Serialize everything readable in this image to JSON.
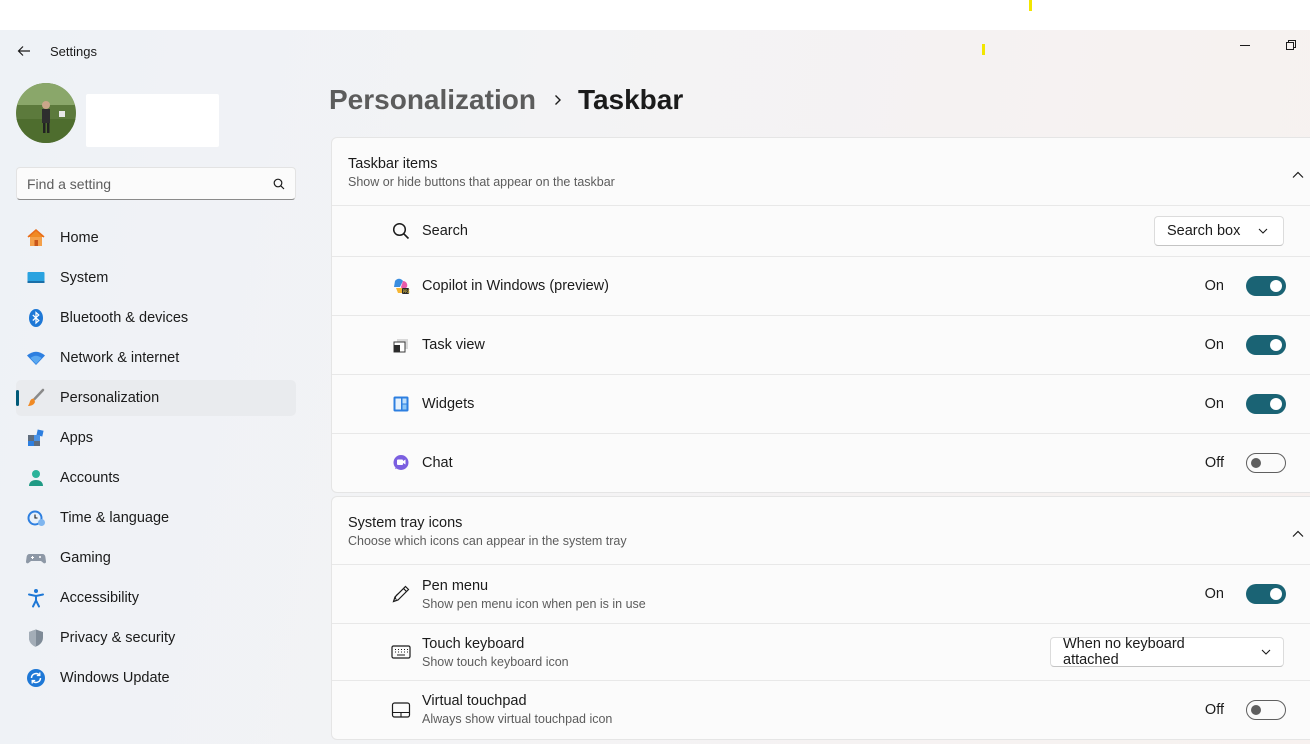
{
  "app": {
    "title": "Settings"
  },
  "search": {
    "placeholder": "Find a setting"
  },
  "nav": {
    "items": [
      {
        "label": "Home",
        "icon": "home-icon"
      },
      {
        "label": "System",
        "icon": "system-icon"
      },
      {
        "label": "Bluetooth & devices",
        "icon": "bluetooth-icon"
      },
      {
        "label": "Network & internet",
        "icon": "wifi-icon"
      },
      {
        "label": "Personalization",
        "icon": "brush-icon",
        "active": true
      },
      {
        "label": "Apps",
        "icon": "apps-icon"
      },
      {
        "label": "Accounts",
        "icon": "accounts-icon"
      },
      {
        "label": "Time & language",
        "icon": "clock-globe-icon"
      },
      {
        "label": "Gaming",
        "icon": "gamepad-icon"
      },
      {
        "label": "Accessibility",
        "icon": "accessibility-icon"
      },
      {
        "label": "Privacy & security",
        "icon": "shield-icon"
      },
      {
        "label": "Windows Update",
        "icon": "update-icon"
      }
    ]
  },
  "breadcrumb": {
    "parent": "Personalization",
    "current": "Taskbar"
  },
  "taskbar_items": {
    "title": "Taskbar items",
    "subtitle": "Show or hide buttons that appear on the taskbar",
    "rows": [
      {
        "label": "Search",
        "control": "dropdown",
        "value": "Search box",
        "icon": "search-icon"
      },
      {
        "label": "Copilot in Windows (preview)",
        "control": "toggle",
        "state": "On",
        "on": true,
        "icon": "copilot-icon"
      },
      {
        "label": "Task view",
        "control": "toggle",
        "state": "On",
        "on": true,
        "icon": "task-view-icon"
      },
      {
        "label": "Widgets",
        "control": "toggle",
        "state": "On",
        "on": true,
        "icon": "widgets-icon"
      },
      {
        "label": "Chat",
        "control": "toggle",
        "state": "Off",
        "on": false,
        "icon": "chat-icon"
      }
    ]
  },
  "system_tray": {
    "title": "System tray icons",
    "subtitle": "Choose which icons can appear in the system tray",
    "rows": [
      {
        "label": "Pen menu",
        "sub": "Show pen menu icon when pen is in use",
        "control": "toggle",
        "state": "On",
        "on": true,
        "icon": "pen-icon"
      },
      {
        "label": "Touch keyboard",
        "sub": "Show touch keyboard icon",
        "control": "dropdown",
        "value": "When no keyboard attached",
        "icon": "keyboard-icon"
      },
      {
        "label": "Virtual touchpad",
        "sub": "Always show virtual touchpad icon",
        "control": "toggle",
        "state": "Off",
        "on": false,
        "icon": "touchpad-icon"
      }
    ]
  },
  "colors": {
    "accent": "#1a6374",
    "nav_active": "#e9ebee"
  }
}
